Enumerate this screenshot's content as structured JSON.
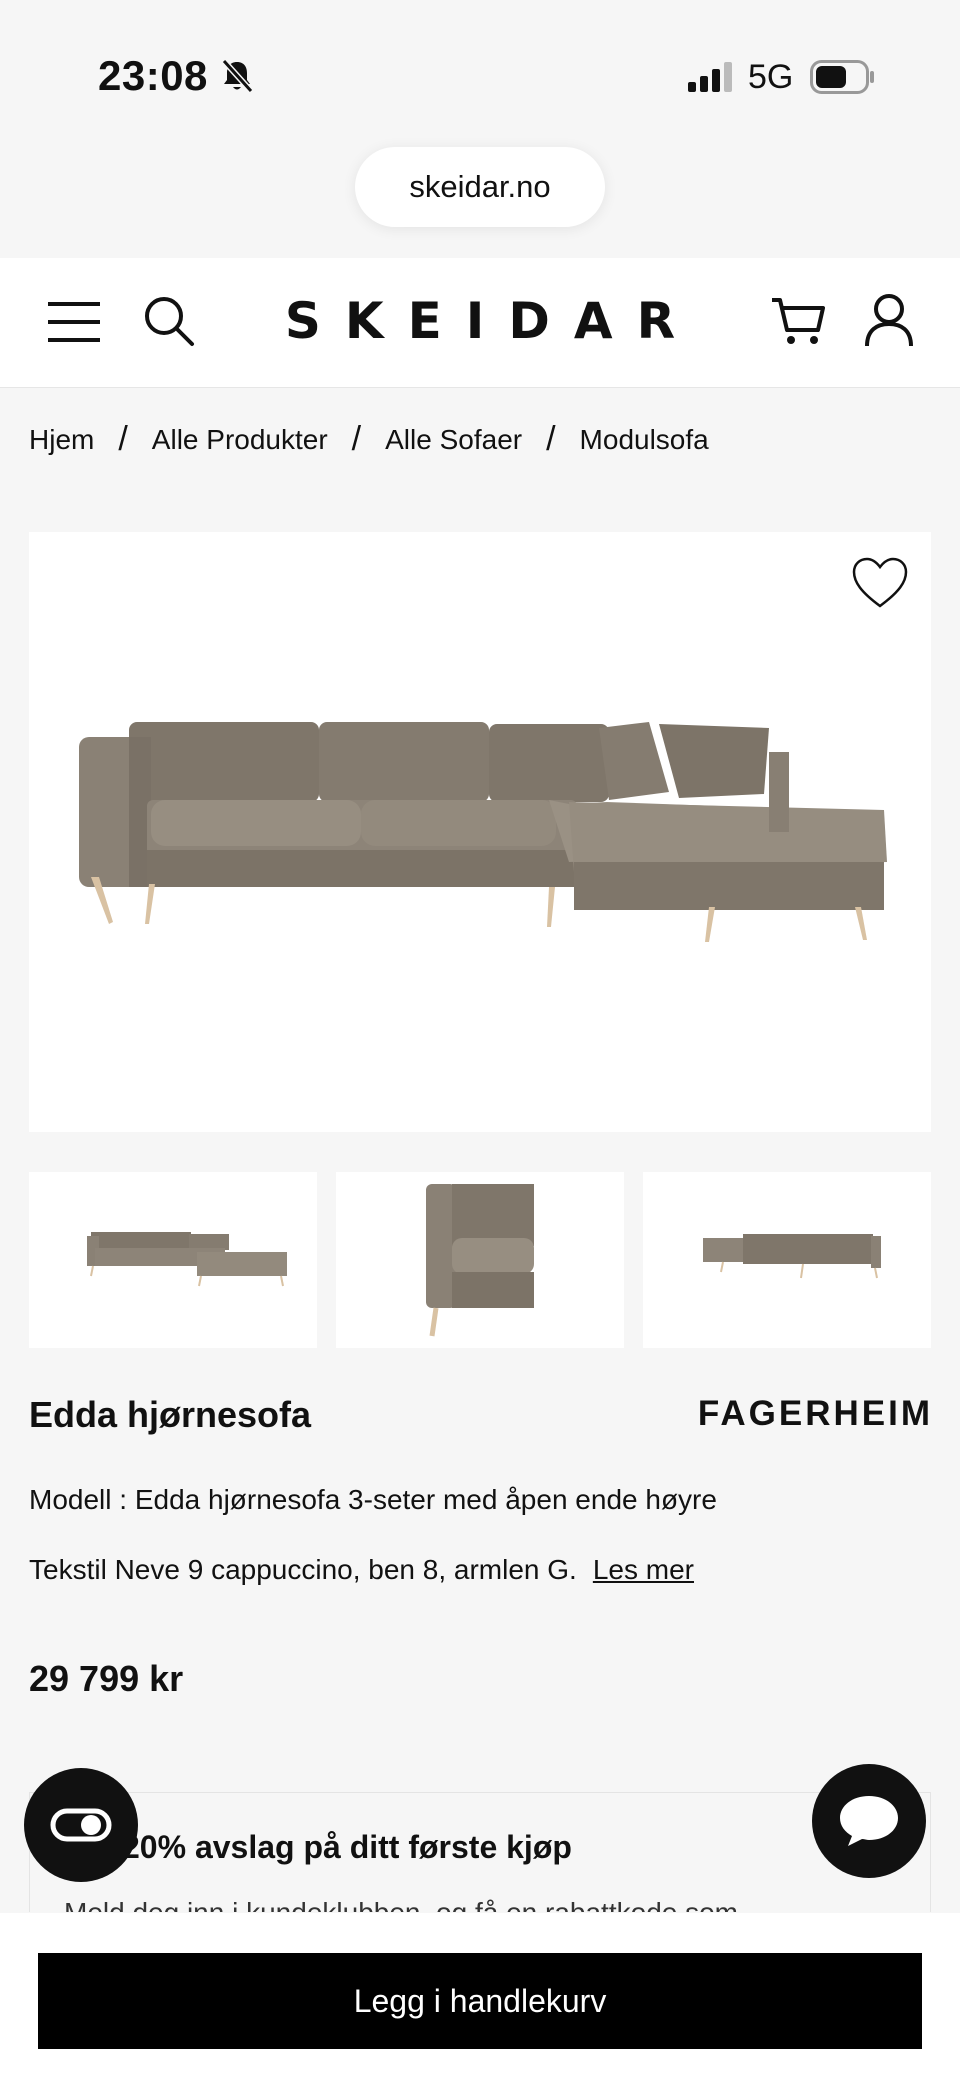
{
  "status": {
    "time": "23:08",
    "network": "5G"
  },
  "browser": {
    "url": "skeidar.no"
  },
  "header": {
    "logo": "SKEIDAR"
  },
  "breadcrumb": [
    "Hjem",
    "Alle Produkter",
    "Alle Sofaer",
    "Modulsofa"
  ],
  "product": {
    "title": "Edda hjørnesofa",
    "brand": "FAGERHEIM",
    "model": "Modell : Edda hjørnesofa 3-seter med åpen ende høyre",
    "description": "Tekstil Neve 9 cappuccino, ben 8, armlen G.",
    "read_more": "Les mer",
    "price": "29 799 kr",
    "sofa_color": "#8b8276"
  },
  "promo": {
    "title": "20% avslag på ditt første kjøp",
    "text": "Meld deg inn i kundeklubben, og få en rabattkode som"
  },
  "cta": {
    "label": "Legg i handlekurv"
  }
}
